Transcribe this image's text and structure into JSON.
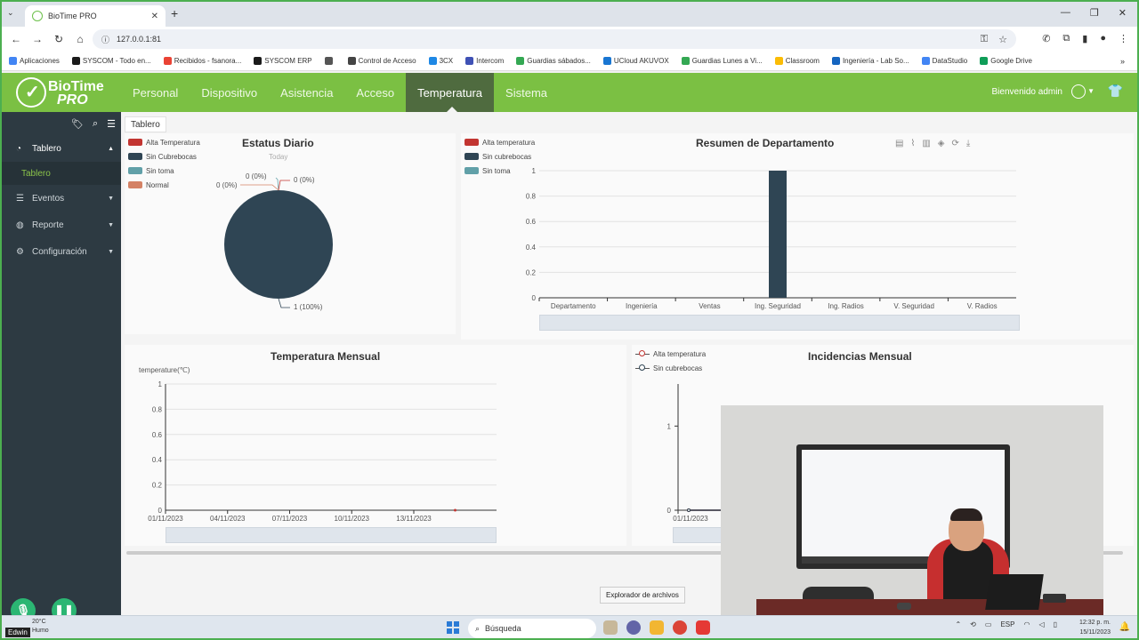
{
  "browser": {
    "tab_title": "BioTime PRO",
    "url": "127.0.0.1:81",
    "bookmarks": [
      {
        "label": "Aplicaciones",
        "color": "#4285f4"
      },
      {
        "label": "SYSCOM - Todo en...",
        "color": "#1a1a1a"
      },
      {
        "label": "Recibidos - fsanora...",
        "color": "#ea4335"
      },
      {
        "label": "SYSCOM ERP",
        "color": "#1a1a1a"
      },
      {
        "label": "",
        "color": "#555555"
      },
      {
        "label": "Control de Acceso",
        "color": "#444444"
      },
      {
        "label": "3CX",
        "color": "#1e88e5"
      },
      {
        "label": "Intercom",
        "color": "#3f51b5"
      },
      {
        "label": "Guardias sábados...",
        "color": "#34a853"
      },
      {
        "label": "UCloud AKUVOX",
        "color": "#1976d2"
      },
      {
        "label": "Guardias Lunes a Vi...",
        "color": "#34a853"
      },
      {
        "label": "Classroom",
        "color": "#fbbc05"
      },
      {
        "label": "Ingeniería - Lab So...",
        "color": "#1565c0"
      },
      {
        "label": "DataStudio",
        "color": "#4285f4"
      },
      {
        "label": "Google Drive",
        "color": "#0f9d58"
      }
    ],
    "bookmarks_more": "»"
  },
  "app": {
    "logo_line1": "BioTime",
    "logo_line2": "PRO",
    "menu": [
      "Personal",
      "Dispositivo",
      "Asistencia",
      "Acceso",
      "Temperatura",
      "Sistema"
    ],
    "active_menu": "Temperatura",
    "welcome": "Bienvenido admin"
  },
  "sidebar": {
    "tablero": "Tablero",
    "tablero_sub": "Tablero",
    "eventos": "Eventos",
    "reporte": "Reporte",
    "configuracion": "Configuración"
  },
  "breadcrumb": "Tablero",
  "estatus": {
    "title": "Estatus Diario",
    "subtitle": "Today",
    "legend": [
      {
        "name": "Alta Temperatura",
        "color": "#c23531"
      },
      {
        "name": "Sin Cubrebocas",
        "color": "#2f4554"
      },
      {
        "name": "Sin toma",
        "color": "#61a0a8"
      },
      {
        "name": "Normal",
        "color": "#d48265"
      }
    ],
    "labels": {
      "a": "0 (0%)",
      "b": "0 (0%)",
      "c": "0 (0%)",
      "d": "1 (100%)"
    }
  },
  "resumen": {
    "title": "Resumen de Departamento",
    "legend": [
      {
        "name": "Alta temperatura",
        "color": "#c23531"
      },
      {
        "name": "Sin cubrebocas",
        "color": "#2f4554"
      },
      {
        "name": "Sin toma",
        "color": "#61a0a8"
      }
    ]
  },
  "temp_mensual": {
    "title": "Temperatura Mensual",
    "ylabel": "temperature(℃)"
  },
  "incidencias": {
    "title": "Incidencias Mensual",
    "legend": [
      {
        "name": "Alta temperatura",
        "color": "#c23531"
      },
      {
        "name": "Sin cubrebocas",
        "color": "#2f4554"
      }
    ]
  },
  "tooltip": "Explorador de archivos",
  "taskbar": {
    "weather_temp": "20°C",
    "weather_desc": "Humo",
    "search": "Búsqueda",
    "lang": "ESP",
    "time": "12:32 p. m.",
    "date": "15/11/2023"
  },
  "call": {
    "name": "Edwin"
  },
  "chart_data": [
    {
      "type": "pie",
      "title": "Estatus Diario",
      "subtitle": "Today",
      "categories": [
        "Alta Temperatura",
        "Sin Cubrebocas",
        "Sin toma",
        "Normal"
      ],
      "values": [
        0,
        1,
        0,
        0
      ],
      "colors": [
        "#c23531",
        "#2f4554",
        "#61a0a8",
        "#d48265"
      ]
    },
    {
      "type": "bar",
      "title": "Resumen de Departamento",
      "categories": [
        "Departamento",
        "Ingeniería",
        "Ventas",
        "Ing. Seguridad",
        "Ing. Radios",
        "V. Seguridad",
        "V. Radios"
      ],
      "series": [
        {
          "name": "Alta temperatura",
          "values": [
            0,
            0,
            0,
            0,
            0,
            0,
            0
          ],
          "color": "#c23531"
        },
        {
          "name": "Sin cubrebocas",
          "values": [
            0,
            0,
            0,
            1,
            0,
            0,
            0
          ],
          "color": "#2f4554"
        },
        {
          "name": "Sin toma",
          "values": [
            0,
            0,
            0,
            0,
            0,
            0,
            0
          ],
          "color": "#61a0a8"
        }
      ],
      "yticks": [
        "0",
        "0.2",
        "0.4",
        "0.6",
        "0.8",
        "1"
      ],
      "ylim": [
        0,
        1
      ],
      "grid": true
    },
    {
      "type": "line",
      "title": "Temperatura Mensual",
      "ylabel": "temperature(℃)",
      "xticks": [
        "01/11/2023",
        "04/11/2023",
        "07/11/2023",
        "10/11/2023",
        "13/11/2023"
      ],
      "yticks": [
        "0",
        "0.2",
        "0.4",
        "0.6",
        "0.8",
        "1"
      ],
      "ylim": [
        0,
        1
      ],
      "series": [
        {
          "values": [
            0
          ],
          "x": [
            "15/11/2023"
          ],
          "color": "#c23531"
        }
      ],
      "grid": true
    },
    {
      "type": "line",
      "title": "Incidencias Mensual",
      "xticks": [
        "01/11/2023"
      ],
      "yticks": [
        "0",
        "1"
      ],
      "ylim": [
        0,
        1.5
      ],
      "series": [
        {
          "name": "Alta temperatura",
          "values": [
            0,
            0
          ],
          "color": "#c23531"
        },
        {
          "name": "Sin cubrebocas",
          "values": [
            0,
            0
          ],
          "color": "#2f4554"
        }
      ]
    }
  ]
}
